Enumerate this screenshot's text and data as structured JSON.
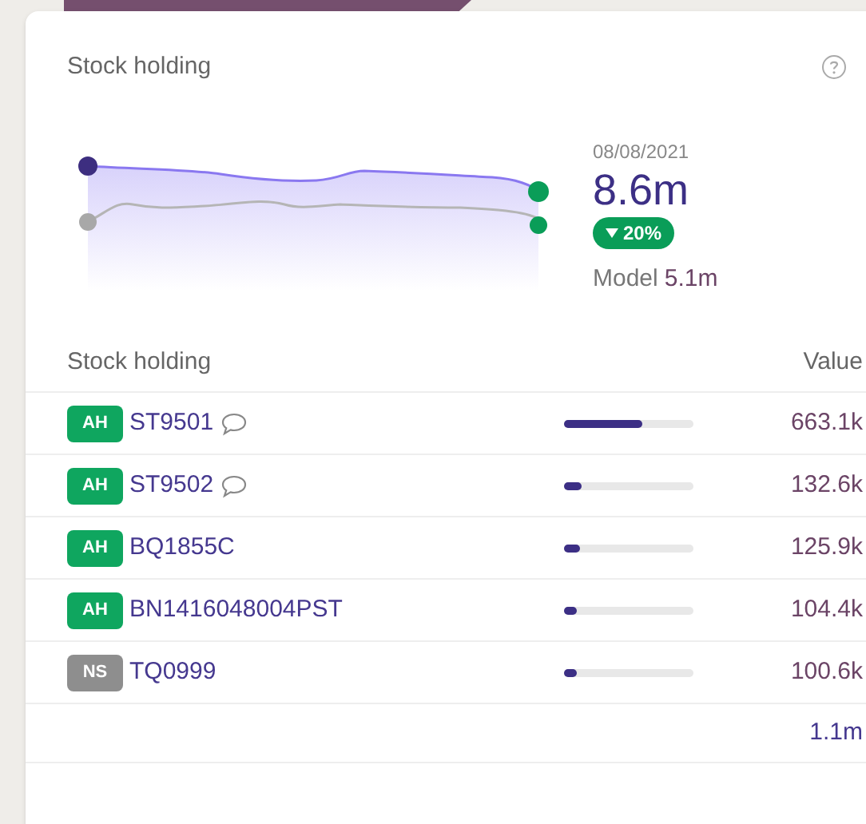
{
  "card": {
    "title": "Stock holding",
    "date": "08/08/2021",
    "value": "8.6m",
    "change": {
      "text": "20%",
      "down": true
    },
    "model_label": "Model",
    "model_value": "5.1m"
  },
  "table": {
    "columns": [
      "Stock holding",
      "Value"
    ],
    "rows": [
      {
        "badge": {
          "text": "AH",
          "color": "#0fa65f"
        },
        "code": "ST9501",
        "has_comment": true,
        "level": 0.6,
        "value": "663.1k"
      },
      {
        "badge": {
          "text": "AH",
          "color": "#0fa65f"
        },
        "code": "ST9502",
        "has_comment": true,
        "level": 0.13,
        "value": "132.6k"
      },
      {
        "badge": {
          "text": "AH",
          "color": "#0fa65f"
        },
        "code": "BQ1855C",
        "has_comment": false,
        "level": 0.12,
        "value": "125.9k"
      },
      {
        "badge": {
          "text": "AH",
          "color": "#0fa65f"
        },
        "code": "BN1416048004PST",
        "has_comment": false,
        "level": 0.1,
        "value": "104.4k"
      },
      {
        "badge": {
          "text": "NS",
          "color": "#8e8e8e"
        },
        "code": "TQ0999",
        "has_comment": false,
        "level": 0.1,
        "value": "100.6k"
      }
    ],
    "total": "1.1m"
  }
}
